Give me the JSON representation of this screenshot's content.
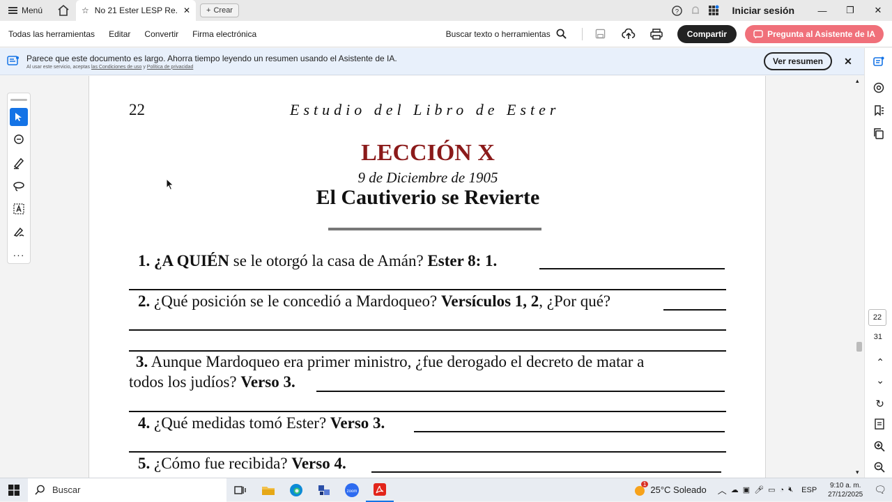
{
  "browser": {
    "menu_label": "Menú",
    "tab_title": "No 21 Ester LESP Re...",
    "new_tab_label": "Crear",
    "signin_label": "Iniciar sesión"
  },
  "toolbar": {
    "items": [
      "Todas las herramientas",
      "Editar",
      "Convertir",
      "Firma electrónica"
    ],
    "search_label": "Buscar texto o herramientas",
    "share_label": "Compartir",
    "ai_label": "Pregunta al Asistente de IA"
  },
  "banner": {
    "message": "Parece que este documento es largo. Ahorra tiempo leyendo un resumen usando el Asistente de IA.",
    "sub_prefix": "Al usar este servicio, aceptas",
    "terms_link": "las Condiciones de uso",
    "sub_and": "y",
    "privacy_link": "Política de privacidad",
    "button_label": "Ver resumen"
  },
  "document": {
    "page_number": "22",
    "header": "Estudio del Libro de Ester",
    "lesson": "LECCIÓN X",
    "date": "9 de Diciembre de 1905",
    "title": "El Cautiverio se Revierte",
    "q1": {
      "num": "1.",
      "bold1": "¿A QUIÉN",
      "text": " se le otorgó la casa de Amán? ",
      "ref": "Ester 8: 1."
    },
    "q2": {
      "num": "2.",
      "text": " ¿Qué posición se le concedió a Mardoqueo? ",
      "ref": "Versículos 1, 2",
      "tail": ", ¿Por qué?"
    },
    "q3": {
      "num": "3.",
      "line1": " Aunque Mardoqueo era primer ministro, ¿fue derogado el decreto de matar a",
      "line2": "todos los judíos? ",
      "ref": "Verso 3."
    },
    "q4": {
      "num": "4.",
      "text": " ¿Qué medidas tomó Ester? ",
      "ref": "Verso 3."
    },
    "q5": {
      "num": "5.",
      "text": " ¿Cómo fue recibida? ",
      "ref": "Verso 4."
    }
  },
  "pager": {
    "current": "22",
    "total": "31"
  },
  "taskbar": {
    "search_placeholder": "Buscar",
    "weather": "25°C Soleado",
    "weather_badge": "1",
    "lang": "ESP",
    "time": "9:10 a. m.",
    "date": "27/12/2025"
  },
  "colors": {
    "accent": "#1473e6",
    "ai": "#f0707a",
    "lesson": "#8b1a1a"
  }
}
